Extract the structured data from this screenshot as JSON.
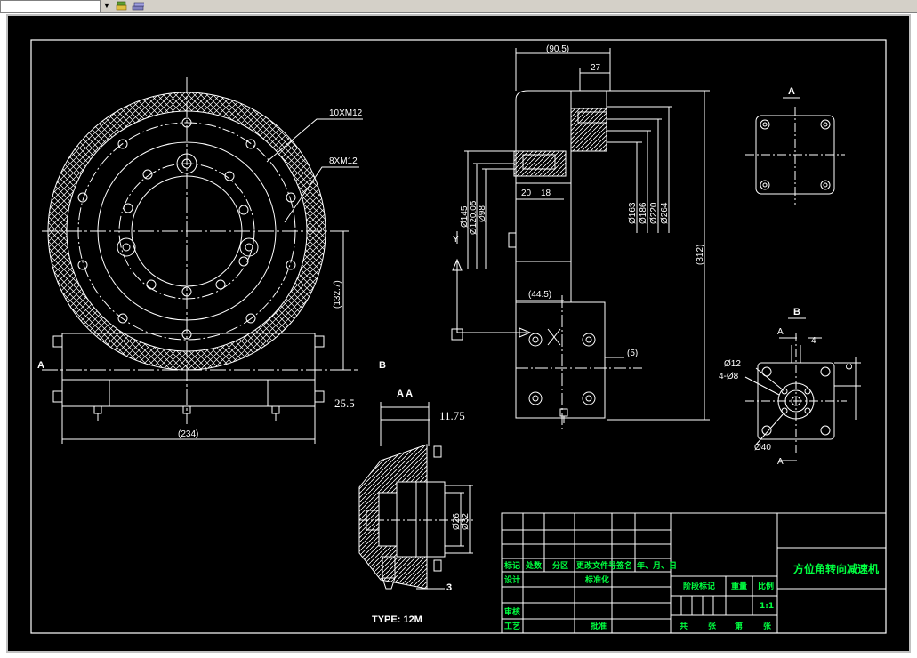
{
  "toolbar": {
    "layer_combo": "",
    "icons": [
      "layers-icon",
      "layer-state-icon"
    ]
  },
  "drawing": {
    "colors": {
      "background": "#000000",
      "lines": "#ffffff",
      "title_text": "#00ff40",
      "hatch": "#ffffff"
    },
    "front_view": {
      "bolt_callout_outer": "10XM12",
      "bolt_callout_inner": "8XM12",
      "dim_height": "(132.7)",
      "dim_width": "(234)",
      "label_a": "A",
      "label_b": "B"
    },
    "side_view": {
      "dim_total": "(90.5)",
      "dim_27": "27",
      "dim_20": "20",
      "dim_18": "18",
      "dim_d145": "Ø145",
      "dim_d120": "Ø120.05",
      "dim_d98": "Ø98",
      "dim_d163": "Ø163",
      "dim_d186": "Ø186",
      "dim_d220": "Ø220",
      "dim_d264": "Ø264",
      "dim_312": "(312)",
      "dim_44": "(44.5)",
      "dim_5": "(5)",
      "ucs_y": "Y"
    },
    "view_a": {
      "label": "A"
    },
    "view_b": {
      "label": "B",
      "label_a_top": "A",
      "label_a_bottom": "A",
      "dim_4": "4",
      "dim_c": "C",
      "dim_d12": "Ø12",
      "dim_holes": "4-Ø8",
      "dim_d40": "Ø40"
    },
    "section_aa": {
      "label": "A A",
      "dim_25_5": "25.5",
      "dim_11_75": "11.75",
      "dim_d26": "Ø26",
      "dim_d32": "Ø32",
      "dim_3": "3",
      "type_note": "TYPE: 12M"
    },
    "title_block": {
      "title": "方位角转向减速机",
      "row_labels": [
        "标记",
        "处数",
        "分区",
        "更改文件号",
        "签名",
        "年、月、日"
      ],
      "design": "设计",
      "standardize": "标准化",
      "check": "审核",
      "process": "工艺",
      "approve": "批准",
      "stage_mark": "阶段标记",
      "weight": "重量",
      "scale": "比例",
      "scale_value": "1:1",
      "sheets": [
        "共",
        "张",
        "第",
        "张"
      ]
    }
  }
}
